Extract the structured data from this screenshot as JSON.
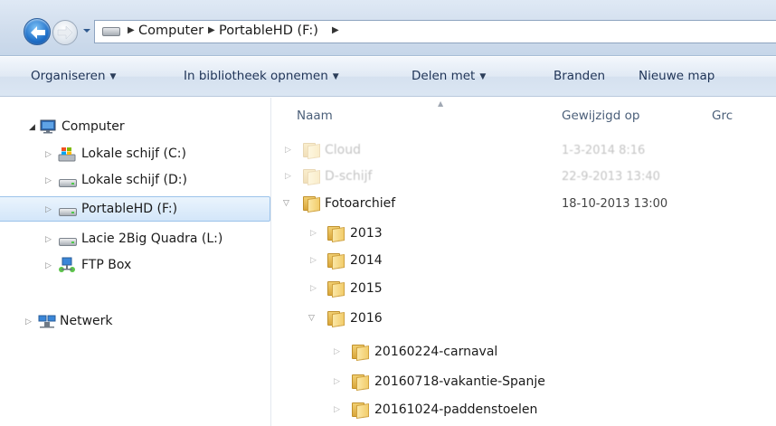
{
  "address": {
    "crumbs": [
      "Computer",
      "PortableHD (F:)"
    ]
  },
  "toolbar": {
    "organize": "Organiseren",
    "include_library": "In bibliotheek opnemen",
    "share_with": "Delen met",
    "burn": "Branden",
    "new_folder": "Nieuwe map"
  },
  "nav": {
    "computer": "Computer",
    "drives": [
      "Lokale schijf (C:)",
      "Lokale schijf (D:)",
      "PortableHD (F:)",
      "Lacie 2Big Quadra (L:)",
      "FTP Box"
    ],
    "network": "Netwerk"
  },
  "columns": {
    "name": "Naam",
    "modified": "Gewijzigd op",
    "size_partial": "Grc"
  },
  "rows": [
    {
      "name": "Cloud",
      "date": "1-3-2014 8:16"
    },
    {
      "name": "D-schijf",
      "date": "22-9-2013 13:40"
    },
    {
      "name": "Fotoarchief",
      "date": "18-10-2013 13:00"
    },
    {
      "name": "2013",
      "date": ""
    },
    {
      "name": "2014",
      "date": ""
    },
    {
      "name": "2015",
      "date": ""
    },
    {
      "name": "2016",
      "date": ""
    },
    {
      "name": "20160224-carnaval",
      "date": ""
    },
    {
      "name": "20160718-vakantie-Spanje",
      "date": ""
    },
    {
      "name": "20161024-paddenstoelen",
      "date": ""
    }
  ],
  "colors": {
    "selection": "#d3e6f9",
    "toolbar_text": "#1e3356"
  }
}
